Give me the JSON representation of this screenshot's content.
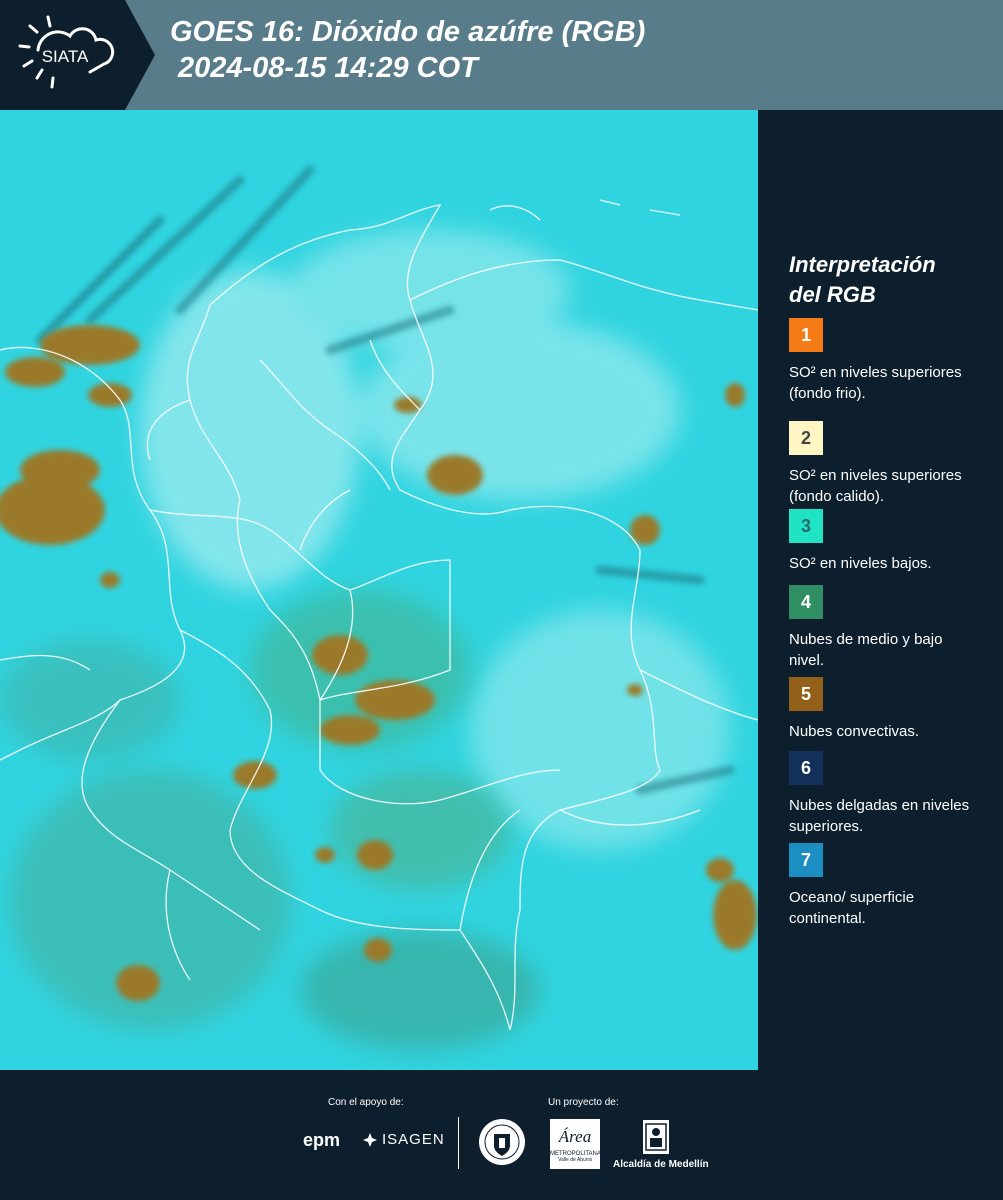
{
  "header": {
    "logo_text": "SIATA",
    "title_line1": "GOES 16: Dióxido de azúfre (RGB)",
    "title_line2": "2024-08-15 14:29 COT"
  },
  "legend": {
    "title_line1": "Interpretación",
    "title_line2": "del RGB",
    "items": [
      {
        "number": "1",
        "color": "#f47b16",
        "text_color": "#ffffff",
        "label": "SO² en niveles superiores (fondo frio)."
      },
      {
        "number": "2",
        "color": "#fdf5c3",
        "text_color": "#444444",
        "label": "SO² en niveles superiores (fondo calido)."
      },
      {
        "number": "3",
        "color": "#1fe3c3",
        "text_color": "#2a6b6b",
        "label": "SO² en niveles bajos."
      },
      {
        "number": "4",
        "color": "#2f8f63",
        "text_color": "#ffffff",
        "label": "Nubes de medio y bajo nivel."
      },
      {
        "number": "5",
        "color": "#93601a",
        "text_color": "#ffffff",
        "label": "Nubes convectivas."
      },
      {
        "number": "6",
        "color": "#12305a",
        "text_color": "#ffffff",
        "label": "Nubes delgadas en niveles superiores."
      },
      {
        "number": "7",
        "color": "#1b8fc1",
        "text_color": "#ffffff",
        "label": "Oceano/ superficie continental."
      }
    ]
  },
  "footer": {
    "support_label": "Con el apoyo de:",
    "project_label": "Un proyecto de:",
    "epm": "epm",
    "isagen": "ISAGEN",
    "area_logo": "Área",
    "area_sub1": "METROPOLITANA",
    "area_sub2": "Valle de Aburrá",
    "alcaldia": "Alcaldía de Medellín"
  }
}
